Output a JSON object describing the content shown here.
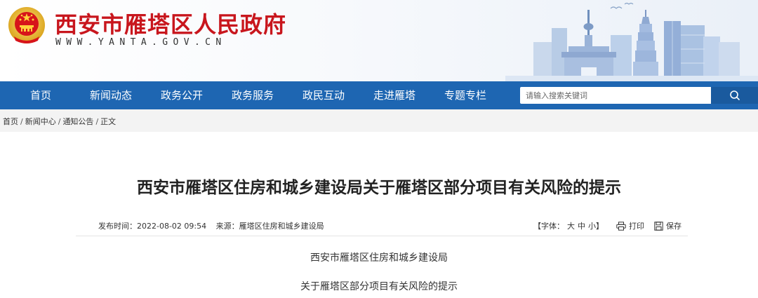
{
  "header": {
    "site_title": "西安市雁塔区人民政府",
    "site_domain": "WWW.YANTA.GOV.CN",
    "emblem_icon": "national-emblem-icon",
    "title_color": "#c8161d"
  },
  "nav": {
    "bg_color": "#1e66b2",
    "items": [
      {
        "label": "首页"
      },
      {
        "label": "新闻动态"
      },
      {
        "label": "政务公开"
      },
      {
        "label": "政务服务"
      },
      {
        "label": "政民互动"
      },
      {
        "label": "走进雁塔"
      },
      {
        "label": "专题专栏"
      }
    ],
    "search": {
      "placeholder": "请输入搜索关键词",
      "button_icon": "search-icon"
    }
  },
  "breadcrumb": {
    "items": [
      "首页",
      "新闻中心",
      "通知公告",
      "正文"
    ],
    "separator": "/"
  },
  "article": {
    "title": "西安市雁塔区住房和城乡建设局关于雁塔区部分项目有关风险的提示",
    "publish_label": "发布时间：",
    "publish_time": "2022-08-02 09:54",
    "source_label": "来源：",
    "source": "雁塔区住房和城乡建设局",
    "font_size_label": "【字体：",
    "font_sizes": [
      "大",
      "中",
      "小"
    ],
    "font_size_close": "】",
    "print_label": "打印",
    "save_label": "保存",
    "body_lines": [
      "西安市雁塔区住房和城乡建设局",
      "关于雁塔区部分项目有关风险的提示"
    ]
  }
}
